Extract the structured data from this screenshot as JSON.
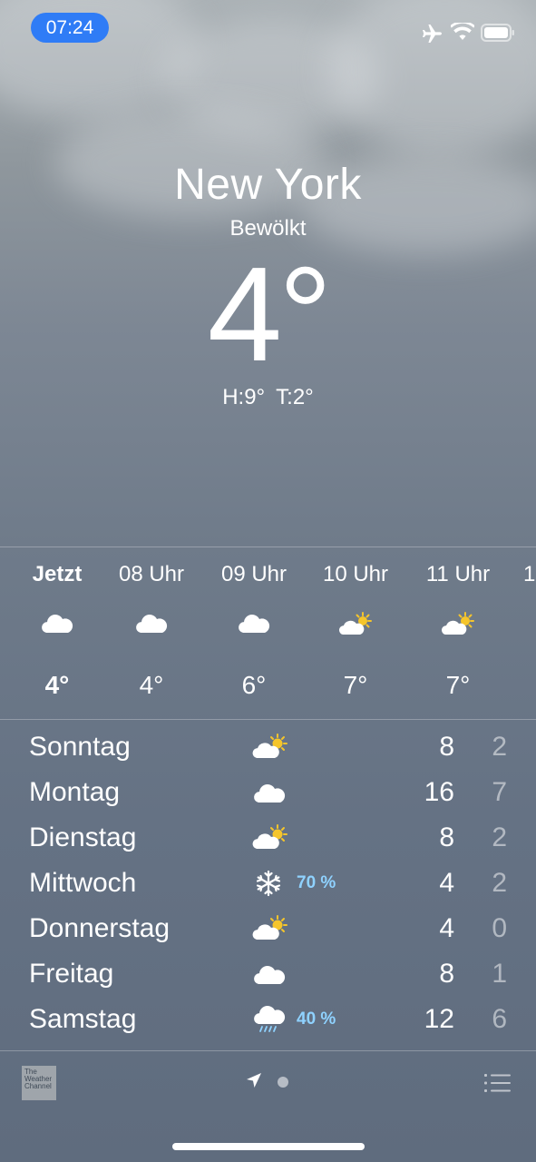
{
  "status_bar": {
    "time": "07:24",
    "icons": [
      "airplane-icon",
      "wifi-icon",
      "battery-icon"
    ]
  },
  "location": {
    "city": "New York",
    "condition": "Bewölkt",
    "temperature": "4°",
    "high": "H:9°",
    "low": "T:2°"
  },
  "hourly": [
    {
      "label": "Jetzt",
      "icon": "cloud-icon",
      "temp": "4°"
    },
    {
      "label": "08 Uhr",
      "icon": "cloud-icon",
      "temp": "4°"
    },
    {
      "label": "09 Uhr",
      "icon": "cloud-icon",
      "temp": "6°"
    },
    {
      "label": "10 Uhr",
      "icon": "partly-sunny-icon",
      "temp": "7°"
    },
    {
      "label": "11 Uhr",
      "icon": "partly-sunny-icon",
      "temp": "7°"
    },
    {
      "label": "1",
      "icon": "",
      "temp": ""
    }
  ],
  "daily": [
    {
      "day": "Sonntag",
      "icon": "partly-sunny-icon",
      "precip": "",
      "high": "8",
      "low": "2"
    },
    {
      "day": "Montag",
      "icon": "cloud-icon",
      "precip": "",
      "high": "16",
      "low": "7"
    },
    {
      "day": "Dienstag",
      "icon": "partly-sunny-icon",
      "precip": "",
      "high": "8",
      "low": "2"
    },
    {
      "day": "Mittwoch",
      "icon": "snowflake-icon",
      "precip": "70 %",
      "high": "4",
      "low": "2"
    },
    {
      "day": "Donnerstag",
      "icon": "partly-sunny-icon",
      "precip": "",
      "high": "4",
      "low": "0"
    },
    {
      "day": "Freitag",
      "icon": "cloud-icon",
      "precip": "",
      "high": "8",
      "low": "1"
    },
    {
      "day": "Samstag",
      "icon": "rain-cloud-icon",
      "precip": "40 %",
      "high": "12",
      "low": "6"
    }
  ],
  "bottom_bar": {
    "logo_text": "The Weather Channel",
    "icons": [
      "location-arrow-icon",
      "page-indicator",
      "list-icon"
    ]
  },
  "colors": {
    "time_pill": "#2f7cf6",
    "precip_text": "#8fd2ff",
    "sun": "#f5c52b"
  }
}
